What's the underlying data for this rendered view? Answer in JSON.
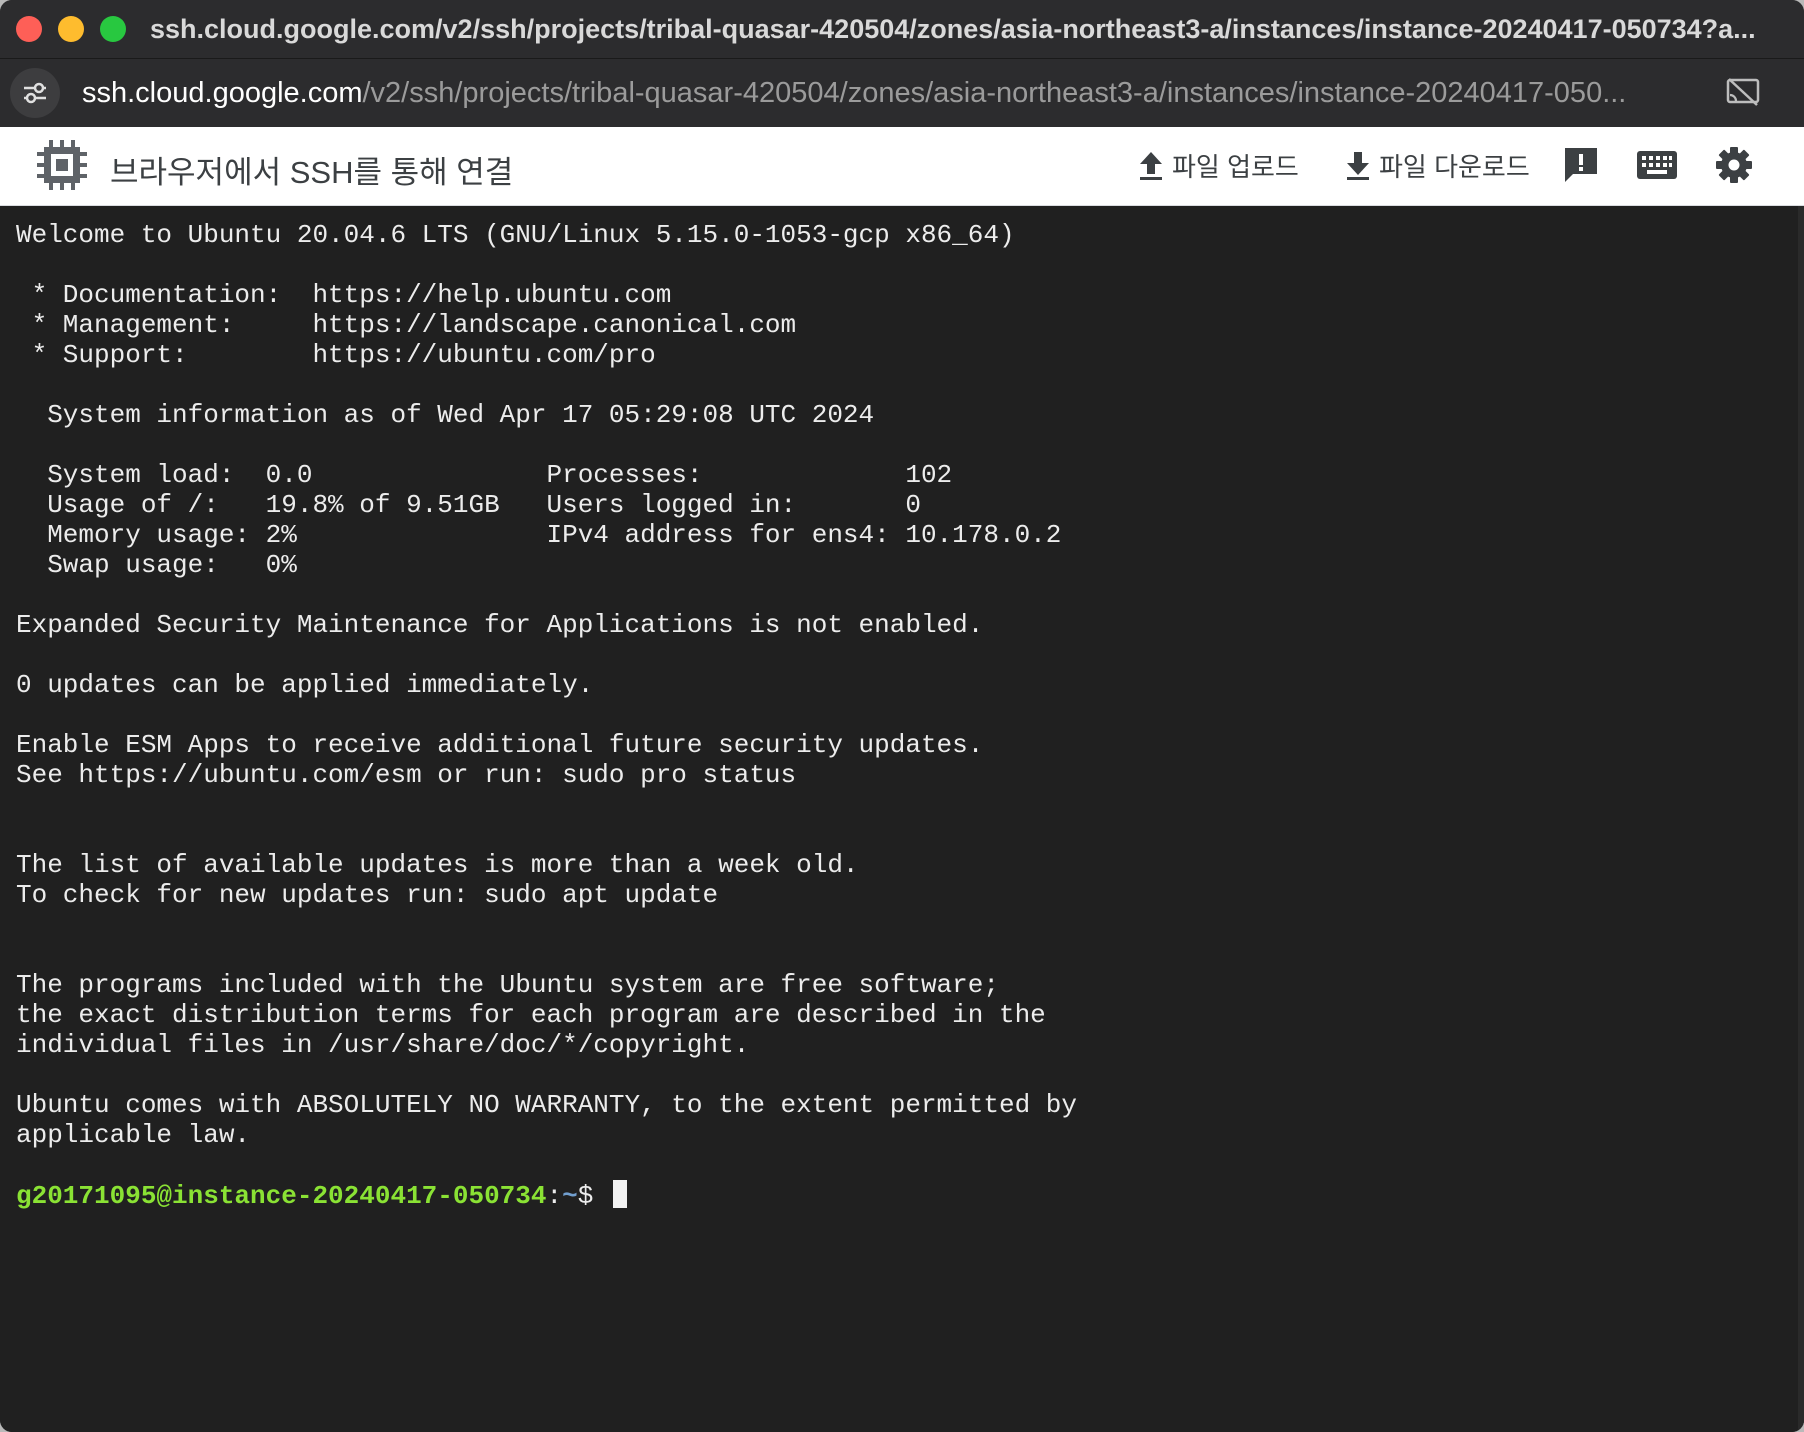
{
  "window": {
    "title": "ssh.cloud.google.com/v2/ssh/projects/tribal-quasar-420504/zones/asia-northeast3-a/instances/instance-20240417-050734?a..."
  },
  "addressbar": {
    "url_host": "ssh.cloud.google.com",
    "url_path": "/v2/ssh/projects/tribal-quasar-420504/zones/asia-northeast3-a/instances/instance-20240417-050..."
  },
  "header": {
    "title": "브라우저에서 SSH를 통해 연결",
    "upload_label": "파일 업로드",
    "download_label": "파일 다운로드"
  },
  "icons": {
    "site_info": "tune-icon",
    "cast": "cast-off-icon",
    "app": "chip-icon",
    "upload": "upload-icon",
    "download": "download-icon",
    "feedback": "feedback-icon",
    "keyboard": "keyboard-icon",
    "settings": "gear-icon"
  },
  "terminal": {
    "lines": [
      "Welcome to Ubuntu 20.04.6 LTS (GNU/Linux 5.15.0-1053-gcp x86_64)",
      "",
      " * Documentation:  https://help.ubuntu.com",
      " * Management:     https://landscape.canonical.com",
      " * Support:        https://ubuntu.com/pro",
      "",
      "  System information as of Wed Apr 17 05:29:08 UTC 2024",
      "",
      "  System load:  0.0               Processes:             102",
      "  Usage of /:   19.8% of 9.51GB   Users logged in:       0",
      "  Memory usage: 2%                IPv4 address for ens4: 10.178.0.2",
      "  Swap usage:   0%",
      "",
      "Expanded Security Maintenance for Applications is not enabled.",
      "",
      "0 updates can be applied immediately.",
      "",
      "Enable ESM Apps to receive additional future security updates.",
      "See https://ubuntu.com/esm or run: sudo pro status",
      "",
      "",
      "The list of available updates is more than a week old.",
      "To check for new updates run: sudo apt update",
      "",
      "",
      "The programs included with the Ubuntu system are free software;",
      "the exact distribution terms for each program are described in the",
      "individual files in /usr/share/doc/*/copyright.",
      "",
      "Ubuntu comes with ABSOLUTELY NO WARRANTY, to the extent permitted by",
      "applicable law.",
      ""
    ],
    "prompt_user": "g20171095@instance-20240417-050734",
    "prompt_sep": ":",
    "prompt_path": "~",
    "prompt_symbol": "$ "
  },
  "colors": {
    "terminal_bg": "#202020",
    "terminal_fg": "#ececec",
    "prompt_user": "#8ae234",
    "prompt_path": "#729fcf"
  }
}
